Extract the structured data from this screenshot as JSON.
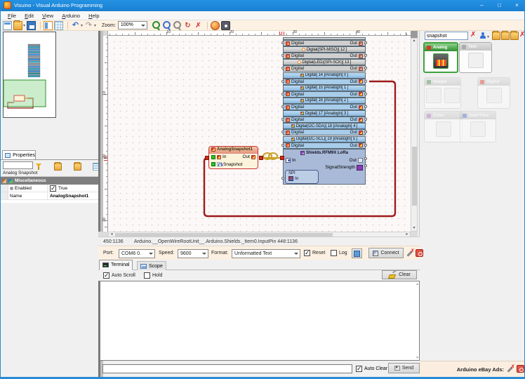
{
  "window": {
    "title": "Visuino - Visual Arduino Programming",
    "minimize": "–",
    "maximize": "□",
    "close": "×"
  },
  "menu": {
    "items": [
      "File",
      "Edit",
      "View",
      "Arduino",
      "Help"
    ]
  },
  "toolbar": {
    "zoom_label": "Zoom:",
    "zoom_value": "100%",
    "icons_left": [
      {
        "name": "i-new-project",
        "label": "new-project-icon"
      },
      {
        "name": "i-open-project fold",
        "label": "open-project-icon",
        "dropdown": true
      },
      {
        "name": "i-save-project",
        "label": "save-project-icon"
      },
      {
        "name": "i-view-structure",
        "label": "view-structure-icon"
      },
      {
        "name": "i-view-grid",
        "label": "view-grid-icon"
      },
      {
        "name": "i-undo glyph",
        "label": "undo-icon",
        "dropdown": true
      },
      {
        "name": "i-redo glyph",
        "label": "redo-icon",
        "dropdown": true
      }
    ],
    "icons_right": [
      {
        "name": "i-zoom-in mag",
        "label": "zoom-in-icon"
      },
      {
        "name": "i-zoom-out mag",
        "label": "zoom-out-icon"
      },
      {
        "name": "i-zoom-fit mag",
        "label": "zoom-fit-icon"
      },
      {
        "name": "i-refresh glyph",
        "label": "refresh-icon"
      },
      {
        "name": "i-delete glyph",
        "label": "delete-icon"
      },
      {
        "name": "i-web-link",
        "label": "web-link-icon"
      },
      {
        "name": "i-gallery",
        "label": "gallery-icon"
      }
    ]
  },
  "search": {
    "value": "snapshot"
  },
  "palette": {
    "cards": [
      {
        "label": "Analog",
        "state": "selected",
        "tiles": 1,
        "tint": "#d23a2a"
      },
      {
        "label": "Text",
        "state": "dim",
        "tiles": 1,
        "tint": "#9a9a9a"
      },
      {
        "label": "Integer",
        "state": "disabled",
        "tiles": 2,
        "tint": "#4a8a4a"
      },
      {
        "label": "Digital",
        "state": "disabled",
        "tiles": 1,
        "tint": "#d23a2a"
      },
      {
        "label": "Color",
        "state": "disabled",
        "tiles": 1,
        "tint": "#b06ac0"
      },
      {
        "label": "Date/Time",
        "state": "disabled",
        "tiles": 1,
        "tint": "#4a6ac0"
      }
    ]
  },
  "properties": {
    "tab": "Properties",
    "component": "Analog Snapshot",
    "category": "Miscellaneous",
    "rows": [
      {
        "label": "Enabled",
        "type": "bool",
        "value": "True",
        "checked": true
      },
      {
        "label": "Name",
        "type": "text",
        "value": "AnalogSnapshot1"
      }
    ]
  },
  "canvas": {
    "h_ruler": [
      "10",
      "20",
      "30",
      "40"
    ],
    "v_ruler": [
      "10",
      "20",
      "30"
    ]
  },
  "board": {
    "left_label": "Digital",
    "right_label": "Out",
    "partial": {
      "left": "Digital",
      "right": "Out"
    },
    "pins": [
      {
        "header": "Digital(SPI-MISO)[ 12 ]",
        "kind": "digital"
      },
      {
        "header": "Digital(LED)(SPI-SCK)[ 13 ]",
        "kind": "digital"
      },
      {
        "header": "Digital[ 14 ]/AnalogIn[ 0 ]",
        "kind": "analog",
        "wired": true
      },
      {
        "header": "Digital[ 15 ]/AnalogIn[ 1 ]",
        "kind": "analog"
      },
      {
        "header": "Digital[ 16 ]/AnalogIn[ 2 ]",
        "kind": "analog"
      },
      {
        "header": "Digital[ 17 ]/AnalogIn[ 3 ]",
        "kind": "analog"
      },
      {
        "header": "Digital(I2C-SDA)[ 18 ]/AnalogIn[ 4 ]",
        "kind": "analog"
      },
      {
        "header": "Digital(I2C-SCL)[ 19 ]/AnalogIn[ 5 ]",
        "kind": "analog"
      }
    ],
    "shield": {
      "title": "Shields.RFM9X LoRa",
      "in_label": "In",
      "out_label": "Out",
      "signal_label": "SignalStrength",
      "spi_label": "SPI",
      "spi_in_label": "In"
    }
  },
  "snapshot": {
    "title": "AnalogSnapshot1",
    "in_label": "In",
    "out_label": "Out",
    "snapshot_label": "Snapshot"
  },
  "statusbar": {
    "coords": "450:1136",
    "path": "Arduino.__OpenWireRootUnit__.Arduino.Shields._Item0.InputPin 448:1136"
  },
  "connect": {
    "port_label": "Port:",
    "port_value": "COM6 0.",
    "speed_label": "Speed:",
    "speed_value": "9600",
    "format_label": "Format:",
    "format_value": "Unformatted Text",
    "reset_label": "Reset",
    "reset_checked": true,
    "log_label": "Log",
    "log_checked": false,
    "connect_label": "Connect"
  },
  "terminal": {
    "tab_terminal": "Terminal",
    "tab_scope": "Scope",
    "active_tab": "Terminal",
    "auto_scroll_label": "Auto Scroll",
    "auto_scroll_checked": true,
    "hold_label": "Hold",
    "hold_checked": false,
    "clear_label": "Clear",
    "auto_clear_label": "Auto Clear",
    "auto_clear_checked": true,
    "send_label": "Send",
    "input_value": ""
  },
  "ads": {
    "label": "Arduino eBay Ads:"
  },
  "colors": {
    "titlebar": "#1c85d8",
    "selection_green": "#3fa33f",
    "wire_red": "#9e1a1a",
    "wire_gold": "#c9a227",
    "block_selected_border": "#cc3333"
  }
}
